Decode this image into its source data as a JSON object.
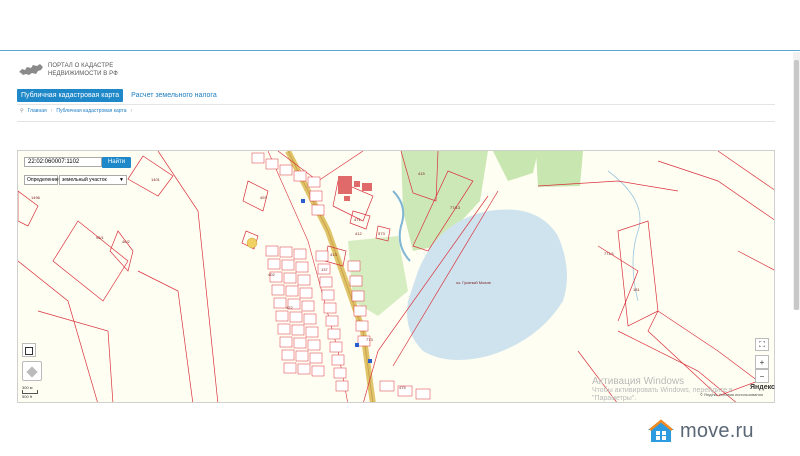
{
  "header": {
    "logo_line1": "ПОРТАЛ О КАДАСТРЕ",
    "logo_line2": "НЕДВИЖИМОСТИ В РФ"
  },
  "tabs": [
    {
      "label": "Публичная кадастровая карта",
      "active": true
    },
    {
      "label": "Расчет земельного налога",
      "active": false
    }
  ],
  "breadcrumb": {
    "home": "Главная",
    "current": "Публичная кадастровая карта",
    "sep": "›"
  },
  "search": {
    "value": "22:02:060007:1102",
    "button": "Найти"
  },
  "selects": {
    "mode": "Определение",
    "type": "земельный участок"
  },
  "map_labels": {
    "lake": "оз. Гусиный Мохов",
    "parcels": [
      "1401",
      "1496",
      "95/1",
      "46/2",
      "493",
      "415",
      "77/13",
      "471",
      "413",
      "412",
      "573",
      "402",
      "475",
      "137",
      "773",
      "422",
      "771/1",
      "181"
    ]
  },
  "map": {
    "scale_top": "300 м",
    "scale_bottom": "500 ft",
    "zoom_in": "+",
    "zoom_out": "−",
    "fullscreen": "⛶",
    "copyright": "© Яндекс  Условия использования",
    "yandex": "Яндекс"
  },
  "activation": {
    "title": "Активация Windows",
    "line1": "Чтобы активировать Windows, перейдите в",
    "line2": "\"Параметры\"."
  },
  "watermark": {
    "text": "move.ru"
  },
  "colors": {
    "accent": "#1e88c9",
    "parcel": "#d9333f",
    "lake": "#cfe3ee",
    "green": "#c8e6b0"
  }
}
